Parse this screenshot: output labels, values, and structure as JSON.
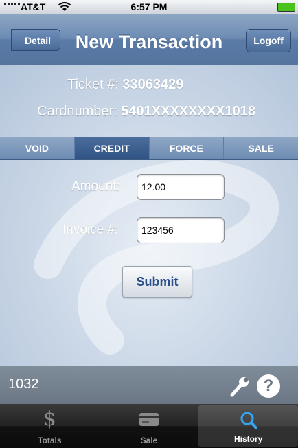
{
  "status_bar": {
    "carrier": "AT&T",
    "time": "6:57 PM"
  },
  "nav": {
    "back_label": "Detail",
    "title": "New Transaction",
    "logoff_label": "Logoff"
  },
  "ticket": {
    "ticket_label": "Ticket #:",
    "ticket_number": "33063429",
    "card_label": "Cardnumber:",
    "card_number": "5401XXXXXXXX1018"
  },
  "segments": [
    {
      "label": "VOID",
      "selected": false
    },
    {
      "label": "CREDIT",
      "selected": true
    },
    {
      "label": "FORCE",
      "selected": false
    },
    {
      "label": "SALE",
      "selected": false
    }
  ],
  "form": {
    "amount_label": "Amount:",
    "amount_value": "12.00",
    "invoice_label": "Invoice #:",
    "invoice_value": "123456",
    "submit_label": "Submit"
  },
  "footer": {
    "count": "1032",
    "wrench_icon": "wrench-icon",
    "help_icon": "help-icon",
    "help_glyph": "?"
  },
  "tabs": [
    {
      "label": "Totals",
      "icon": "dollar-icon",
      "glyph": "$",
      "selected": false
    },
    {
      "label": "Sale",
      "icon": "card-icon",
      "selected": false
    },
    {
      "label": "History",
      "icon": "magnifier-icon",
      "selected": true
    }
  ],
  "colors": {
    "nav": "#6d8cb3",
    "segment_selected": "#2f5384",
    "submit_text": "#2b4f8a",
    "footer": "#6a7684",
    "tabbar": "#111111"
  }
}
